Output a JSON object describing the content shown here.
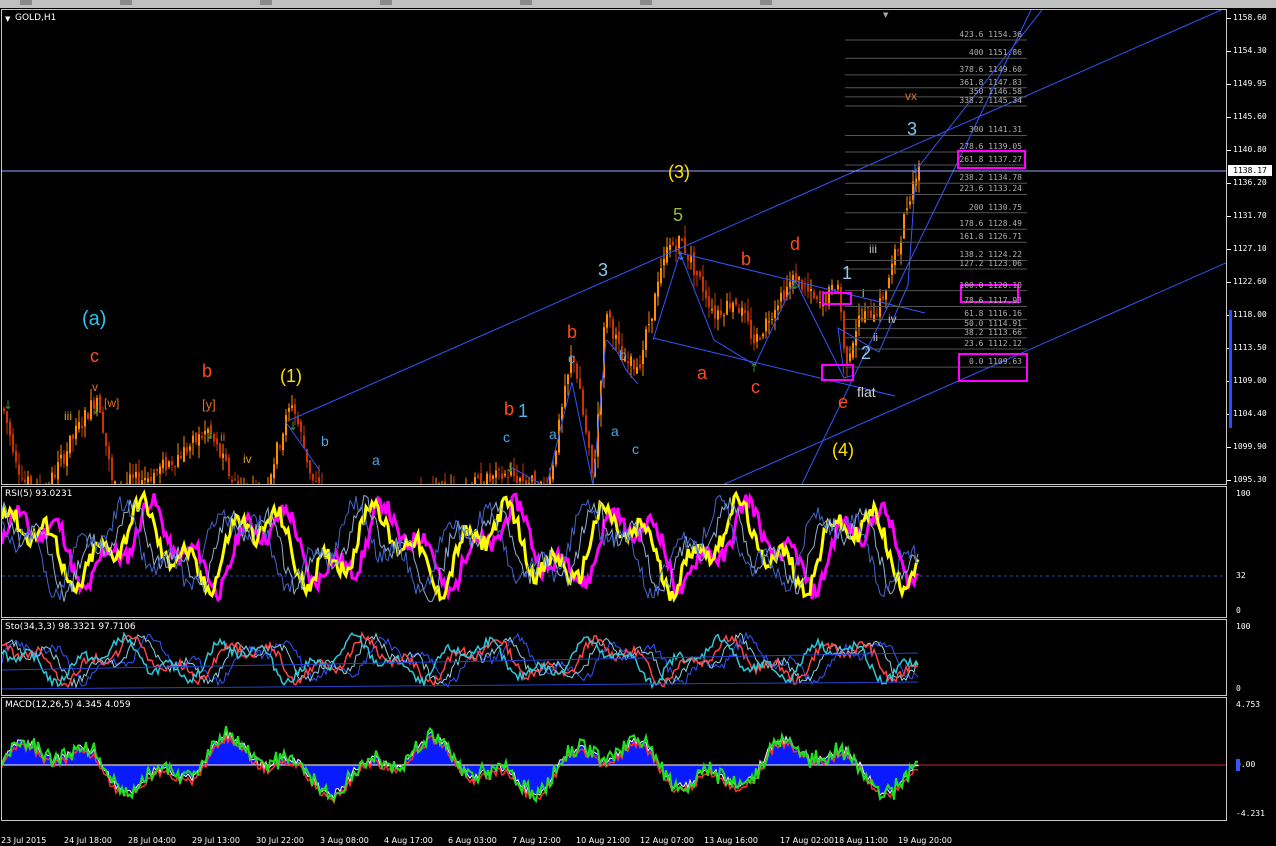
{
  "toolbar": {
    "dropdown_icon": "chevron-down-icon"
  },
  "main_chart": {
    "title": "GOLD,H1",
    "price_labels": [
      "1158.60",
      "1154.30",
      "1149.95",
      "1145.60",
      "1140.80",
      "1136.20",
      "1131.70",
      "1127.10",
      "1122.60",
      "1118.00",
      "1113.50",
      "1109.00",
      "1104.40",
      "1099.90",
      "1095.30"
    ],
    "current_price": "1138.17",
    "colors": {
      "background": "#000000",
      "candle_up": "#ff8c00",
      "candle_down": "#cc3300",
      "channel": "#3355ff",
      "fib": "#a0a0a0",
      "highlight": "#ff00ff"
    },
    "fib_levels": [
      "423.6 1154.36",
      "400 1151.86",
      "378.6 1149.60",
      "361.8 1147.83",
      "350 1146.58",
      "338.2 1145.34",
      "300 1141.31",
      "278.6 1139.05",
      "261.8 1137.27",
      "238.2 1134.78",
      "223.6 1133.24",
      "200 1130.75",
      "178.6 1128.49",
      "161.8 1126.71",
      "138.2 1124.22",
      "127.2 1123.06",
      "100.0 1120.10",
      "78.6 1117.93",
      "61.8 1116.16",
      "50.0 1114.91",
      "38.2 1113.66",
      "23.6 1112.12",
      "0.0 1109.63"
    ],
    "wave_labels": {
      "a_paren": "(a)",
      "c_top": "c",
      "v_small": "v",
      "w_bracket": "[w]",
      "iii_small": "iii",
      "b_red1": "b",
      "y_bracket": "[y]",
      "ii_small": "ii",
      "iv_small": "iv",
      "one_paren": "(1)",
      "b_blue1": "b",
      "a_blue1": "a",
      "b_red2": "b",
      "one_blue": "1",
      "c_blue1": "c",
      "b_red3": "b",
      "c_blue2": "c",
      "a_blue2": "a",
      "b_blue2": "b",
      "a_blue3": "a",
      "c_blue3": "c",
      "three_blue": "3",
      "five_green": "5",
      "three_paren": "(3)",
      "b_red4": "b",
      "d_red": "d",
      "a_red": "a",
      "c_red": "c",
      "e_red": "e",
      "four_paren": "(4)",
      "flat": "flat",
      "one_light": "1",
      "two_light": "2",
      "i_small": "i",
      "ii_small2": "ii",
      "iii_small2": "iii",
      "iv_small2": "iv",
      "three_light": "3",
      "vx": "vx"
    }
  },
  "rsi": {
    "title": "RSI(5) 93.0231",
    "levels": [
      "100",
      "32",
      "0"
    ]
  },
  "stoch": {
    "title": "Sto(34,3,3) 98.3321 97.7106",
    "levels": [
      "100",
      "0"
    ]
  },
  "macd": {
    "title": "MACD(12,26,5) 4.345 4.059",
    "levels": [
      "4.753",
      "0.00",
      "-4.231"
    ]
  },
  "time_axis": [
    "23 Jul 2015",
    "24 Jul 18:00",
    "28 Jul 04:00",
    "29 Jul 13:00",
    "30 Jul 22:00",
    "3 Aug 08:00",
    "4 Aug 17:00",
    "6 Aug 03:00",
    "7 Aug 12:00",
    "10 Aug 21:00",
    "12 Aug 07:00",
    "13 Aug 16:00",
    "17 Aug 02:00",
    "18 Aug 11:00",
    "19 Aug 20:00"
  ]
}
